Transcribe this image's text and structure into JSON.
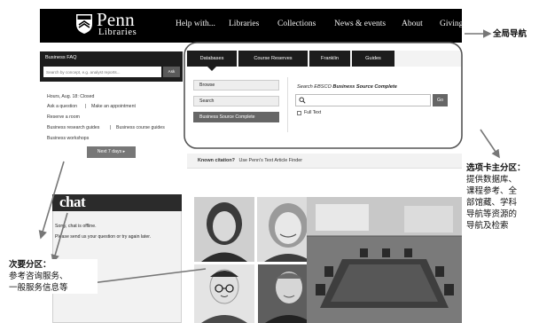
{
  "header": {
    "logo_title": "Penn",
    "logo_subtitle": "Libraries",
    "nav": [
      "Help with...",
      "Libraries",
      "Collections",
      "News & events",
      "About",
      "Giving"
    ]
  },
  "annotations": {
    "global_nav": "全局导航",
    "tabs_title": "选项卡主分区：",
    "tabs_lines": [
      "提供数据库、",
      "课程参考、全",
      "部馆藏、学科",
      "导航等资源的",
      "导航及检索"
    ],
    "secondary_title": "次要分区：",
    "secondary_lines": [
      "参考咨询服务、",
      "一般服务信息等"
    ]
  },
  "faq": {
    "title": "Business FAQ",
    "search_placeholder": "Search by concept, e.g. analyst reports...",
    "ask_label": "Ask",
    "hours": "Hours, Aug. 18: Closed",
    "ask_question": "Ask a question",
    "make_appointment": "Make an appointment",
    "reserve_room": "Reserve a room",
    "research_guides": "Business research guides",
    "course_guides": "Business course guides",
    "workshops": "Business workshops",
    "next_days": "Next 7 days"
  },
  "tabs": {
    "items": [
      "Databases",
      "Course Reserves",
      "Franklin",
      "Guides"
    ],
    "active_index": 0,
    "side_buttons": [
      "Browse",
      "Search",
      "Business Source Complete"
    ],
    "search_label_prefix": "Search EBSCO ",
    "search_label_bold": "Business Source Complete",
    "search_placeholder": "",
    "go_label": "Go",
    "fulltext_label": "Full Text",
    "citation_bold": "Known citation?",
    "citation_text": "Use Penn's Text Article Finder"
  },
  "chat": {
    "logo": "chat",
    "offline_msg": "Sorry, chat is offline.",
    "instruction": "Please send us your question or try again later."
  },
  "colors": {
    "nav_bg": "#000000",
    "panel_dark": "#1d1d1d",
    "active_button": "#666666"
  }
}
